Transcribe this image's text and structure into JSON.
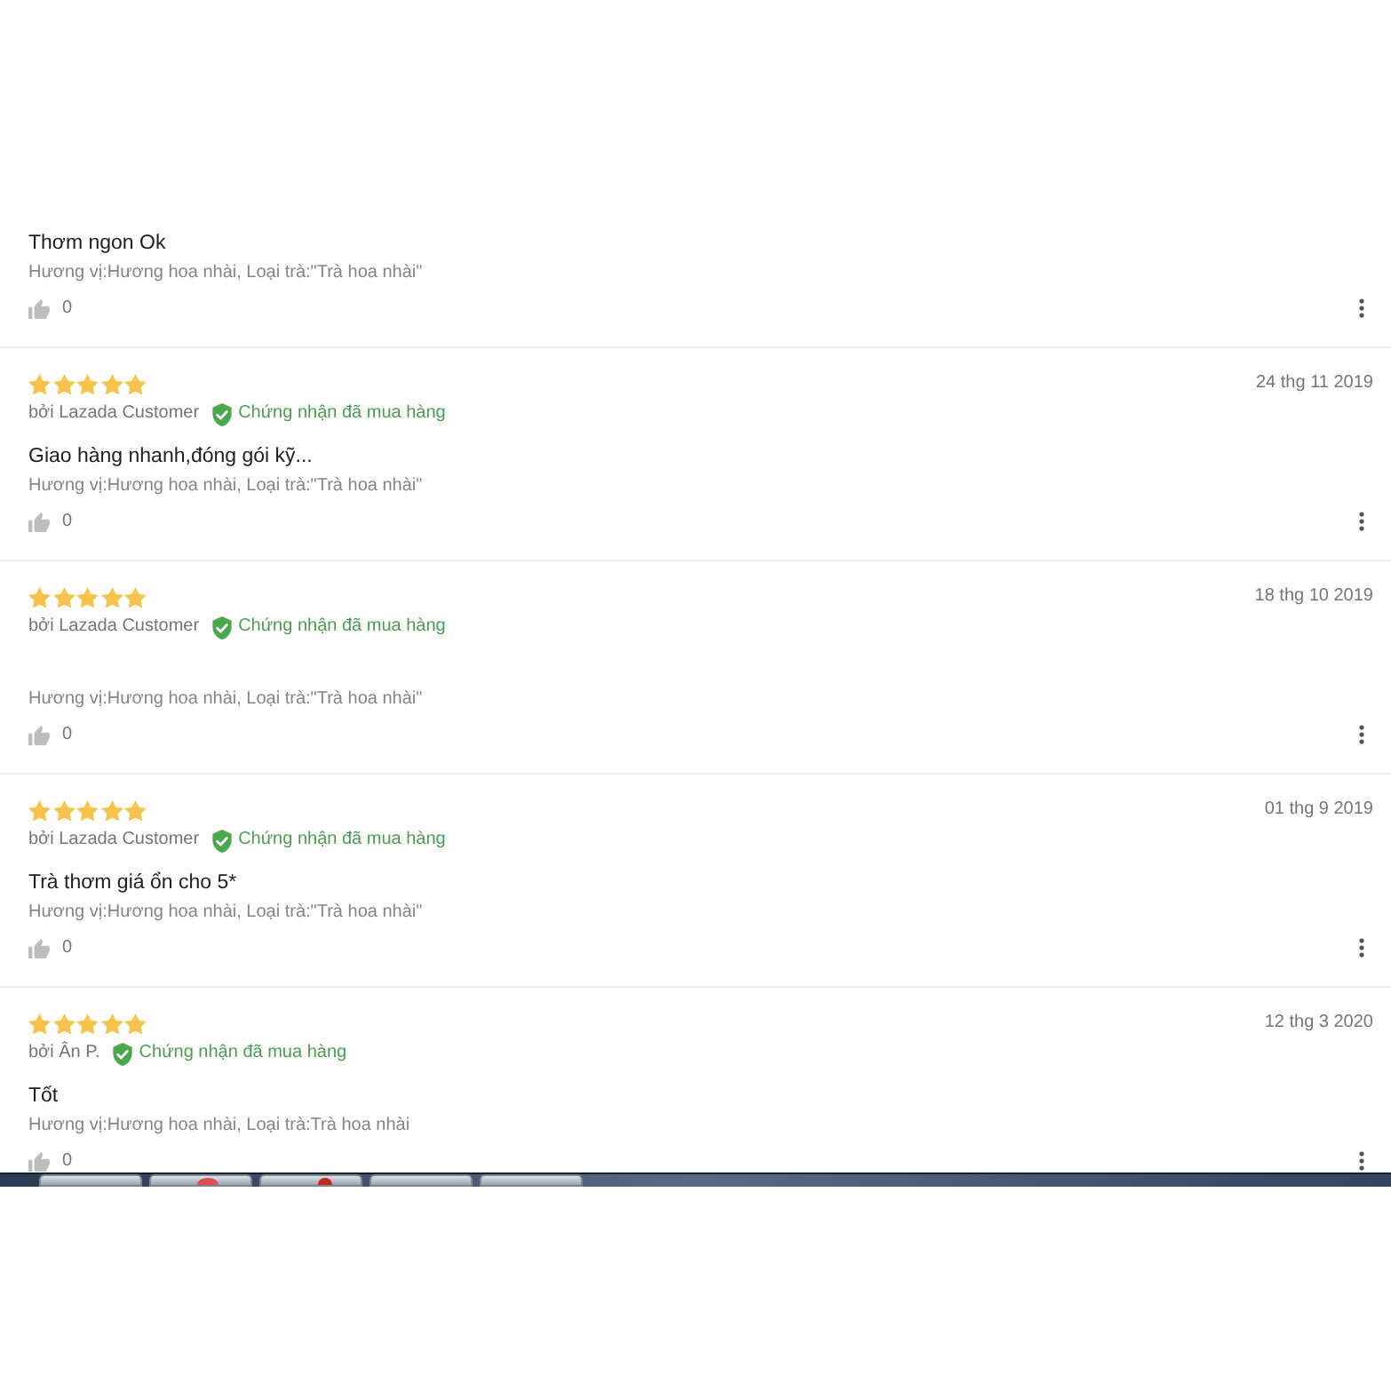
{
  "reviews": [
    {
      "content": "Thơm ngon Ok",
      "variant": "Hương vị:Hương hoa nhài, Loại trà:\"Trà hoa nhài\"",
      "likes": "0"
    },
    {
      "stars": 5,
      "author": "bởi Lazada Customer",
      "verified": true,
      "verified_label": "Chứng nhận đã mua hàng",
      "date": "24 thg 11 2019",
      "content": "Giao hàng nhanh,đóng gói kỹ...",
      "variant": "Hương vị:Hương hoa nhài, Loại trà:\"Trà hoa nhài\"",
      "likes": "0"
    },
    {
      "stars": 5,
      "author": "bởi Lazada Customer",
      "verified": true,
      "verified_label": "Chứng nhận đã mua hàng",
      "date": "18 thg 10 2019",
      "variant": "Hương vị:Hương hoa nhài, Loại trà:\"Trà hoa nhài\"",
      "likes": "0"
    },
    {
      "stars": 5,
      "author": "bởi Lazada Customer",
      "verified": true,
      "verified_label": "Chứng nhận đã mua hàng",
      "date": "01 thg 9 2019",
      "content": "Trà thơm giá ổn cho 5*",
      "variant": "Hương vị:Hương hoa nhài, Loại trà:\"Trà hoa nhài\"",
      "likes": "0"
    },
    {
      "stars": 5,
      "author": "bởi Ân P.",
      "verified": true,
      "verified_label": "Chứng nhận đã mua hàng",
      "date": "12 thg 3 2020",
      "content": "Tốt",
      "variant": "Hương vị:Hương hoa nhài, Loại trà:Trà hoa nhài",
      "likes": "0"
    }
  ]
}
